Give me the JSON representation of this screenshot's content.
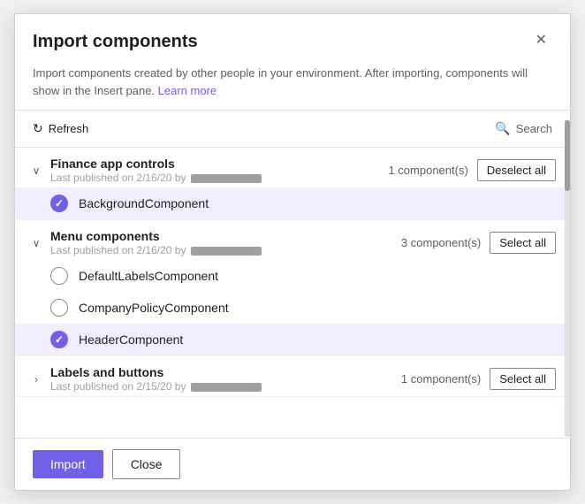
{
  "dialog": {
    "title": "Import components",
    "description": "Import components created by other people in your environment. After importing, components will show in the Insert pane.",
    "learn_more_label": "Learn more",
    "close_label": "✕"
  },
  "toolbar": {
    "refresh_label": "Refresh",
    "search_placeholder": "Search"
  },
  "groups": [
    {
      "id": "finance",
      "name": "Finance app controls",
      "meta_prefix": "Last published on 2/16/20 by",
      "component_count": "1 component(s)",
      "button_label": "Deselect all",
      "expanded": true,
      "components": [
        {
          "name": "BackgroundComponent",
          "selected": true
        }
      ]
    },
    {
      "id": "menu",
      "name": "Menu components",
      "meta_prefix": "Last published on 2/16/20 by",
      "component_count": "3 component(s)",
      "button_label": "Select all",
      "expanded": true,
      "components": [
        {
          "name": "DefaultLabelsComponent",
          "selected": false
        },
        {
          "name": "CompanyPolicyComponent",
          "selected": false
        },
        {
          "name": "HeaderComponent",
          "selected": true
        }
      ]
    },
    {
      "id": "labels",
      "name": "Labels and buttons",
      "meta_prefix": "Last published on 2/15/20 by",
      "component_count": "1 component(s)",
      "button_label": "Select all",
      "expanded": false,
      "components": []
    }
  ],
  "footer": {
    "import_label": "Import",
    "close_label": "Close"
  },
  "colors": {
    "accent": "#7160E8",
    "text_primary": "#201f1e",
    "text_secondary": "#605e5c"
  }
}
